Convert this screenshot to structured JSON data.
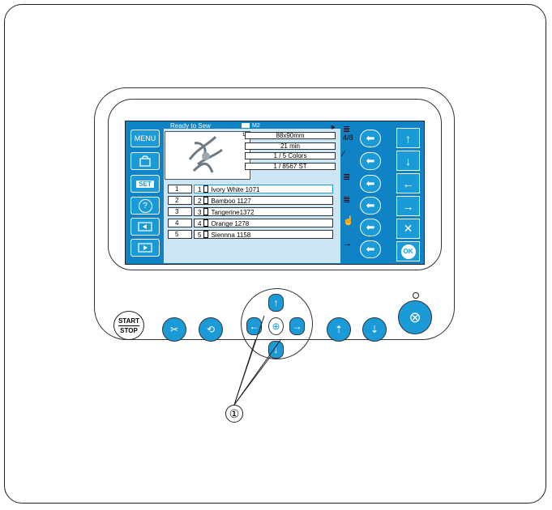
{
  "screen": {
    "status": "Ready to Sew",
    "memory": "M2",
    "design_size": "88x90mm",
    "sew_time": "21 min",
    "color_count": "1 / 5 Colors",
    "stitch_count": "1 / 8567 ST",
    "page_counter": "4/8",
    "thumb_index": "1"
  },
  "left_menu": [
    "MENU",
    "",
    "SET",
    "?",
    "",
    ""
  ],
  "threads": [
    {
      "needle": "1",
      "color": "1",
      "name": "Ivory White 1071"
    },
    {
      "needle": "2",
      "color": "2",
      "name": "Bamboo 1127"
    },
    {
      "needle": "3",
      "color": "3",
      "name": "Tangerine1372"
    },
    {
      "needle": "4",
      "color": "4",
      "name": "Orange 1278"
    },
    {
      "needle": "5",
      "color": "5",
      "name": "Siennna 1158"
    }
  ],
  "right_buttons": {
    "cancel": "✕",
    "ok": "OK"
  },
  "hardware": {
    "start": "START",
    "stop": "STOP"
  },
  "callout_label": "①",
  "colors": {
    "screen_blue": "#0f83c6",
    "button_blue": "#1b9ad8",
    "lcd_bg": "#cde6f5"
  }
}
